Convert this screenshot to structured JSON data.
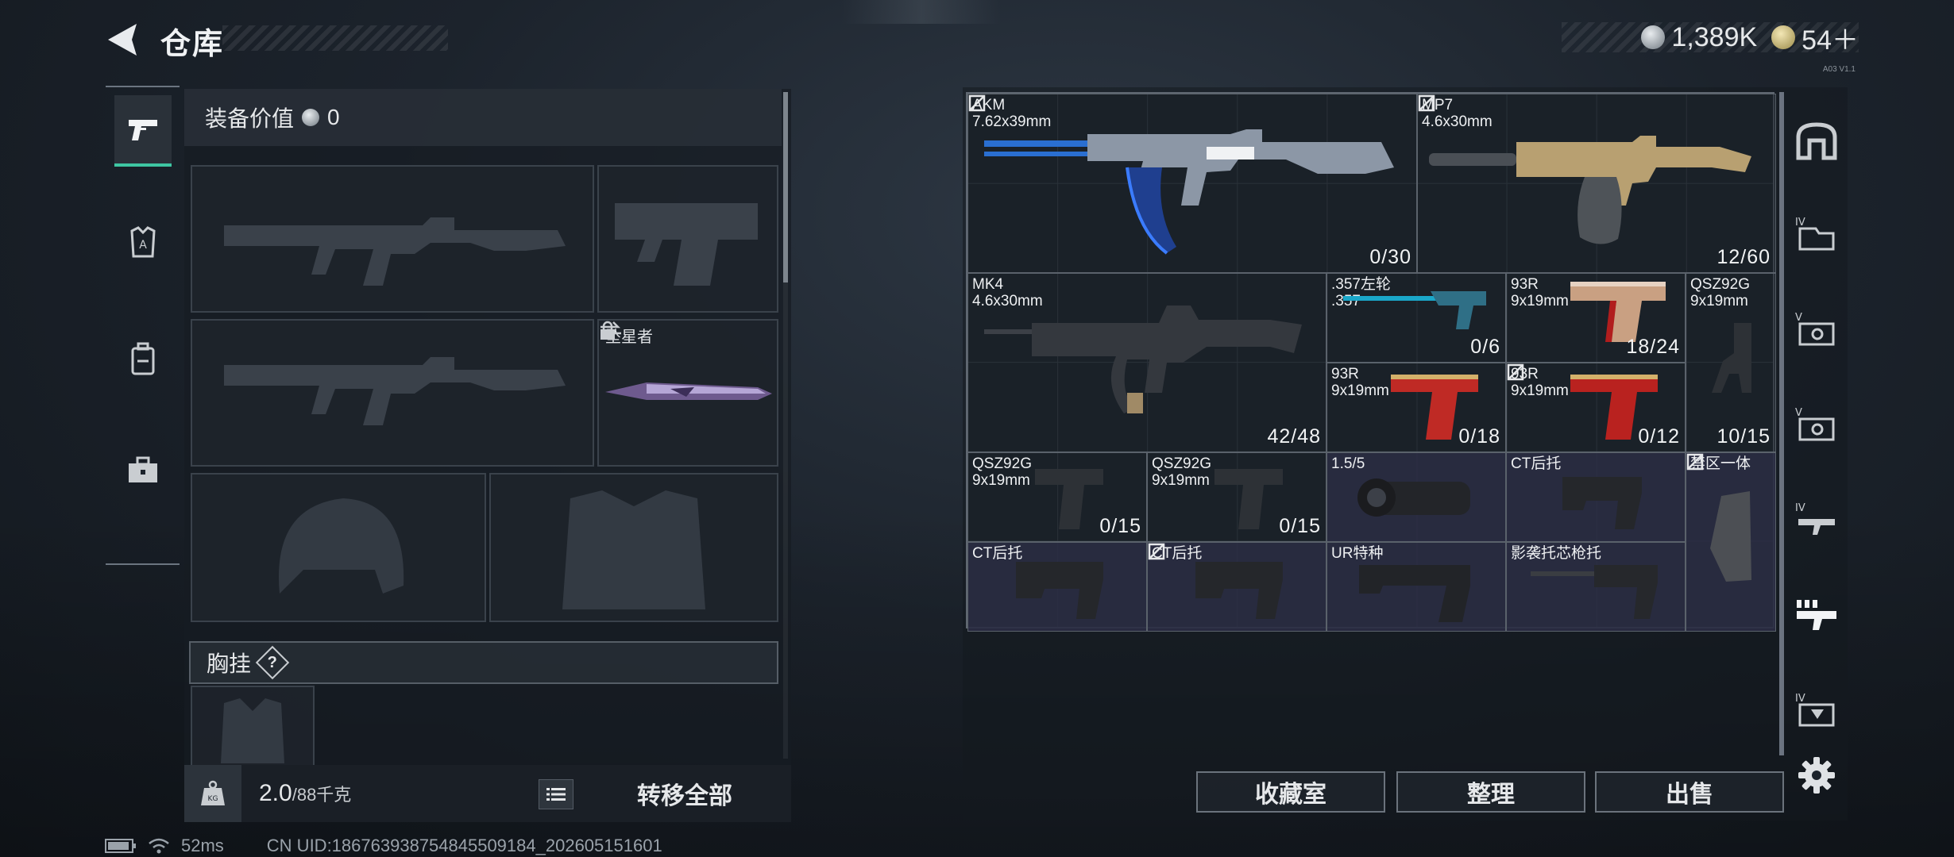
{
  "header": {
    "title": "仓库",
    "currencies": [
      {
        "icon": "silver-coin-icon",
        "value": "1,389K"
      },
      {
        "icon": "gold-badge-icon",
        "value": "54＋"
      }
    ],
    "build_tag": "A03 V1.1"
  },
  "left_nav": [
    {
      "name": "weapons",
      "icon": "pistol-icon",
      "active": true
    },
    {
      "name": "armor",
      "icon": "armor-icon",
      "active": false
    },
    {
      "name": "backpack",
      "icon": "backpack-icon",
      "active": false
    },
    {
      "name": "toolbox",
      "icon": "toolbox-icon",
      "active": false
    }
  ],
  "equipment": {
    "value_label": "装备价值",
    "value": "0",
    "melee_label": "坠星者",
    "chest_label": "胸挂",
    "help": "?",
    "weight": "2.0",
    "weight_capacity": "/88千克",
    "weight_icon_text": "KG",
    "transfer_all": "转移全部"
  },
  "storage": {
    "items": [
      {
        "name": "AKM",
        "caliber": "7.62x39mm",
        "ammo": "0/30"
      },
      {
        "name": "MP7",
        "caliber": "4.6x30mm",
        "ammo": "12/60"
      },
      {
        "name": "MK4",
        "caliber": "4.6x30mm",
        "ammo": "42/48"
      },
      {
        "name": ".357左轮",
        "caliber": ".357",
        "ammo": "0/6"
      },
      {
        "name": "93R",
        "caliber": "9x19mm",
        "ammo": "18/24"
      },
      {
        "name": "QSZ92G",
        "caliber": "9x19mm",
        "ammo": "10/15"
      },
      {
        "name": "93R",
        "caliber": "9x19mm",
        "ammo": "0/18"
      },
      {
        "name": "93R",
        "caliber": "9x19mm",
        "ammo": "0/12"
      },
      {
        "name": "QSZ92G",
        "caliber": "9x19mm",
        "ammo": "0/15"
      },
      {
        "name": "QSZ92G",
        "caliber": "9x19mm",
        "ammo": "0/15"
      },
      {
        "name": "1.5/5",
        "caliber": "",
        "ammo": ""
      },
      {
        "name": "CT后托",
        "caliber": "",
        "ammo": ""
      },
      {
        "name": "禁区一体",
        "caliber": "",
        "ammo": ""
      },
      {
        "name": "CT后托",
        "caliber": "",
        "ammo": ""
      },
      {
        "name": "CT后托",
        "caliber": "",
        "ammo": ""
      },
      {
        "name": "UR特种",
        "caliber": "",
        "ammo": ""
      },
      {
        "name": "影袭托芯枪托",
        "caliber": "",
        "ammo": ""
      }
    ]
  },
  "right_nav": [
    {
      "icon": "storage-home-icon"
    },
    {
      "icon": "folder-iv-icon"
    },
    {
      "icon": "safe-v-icon"
    },
    {
      "icon": "safe-v-icon-2"
    },
    {
      "icon": "rifle-iv-icon"
    },
    {
      "icon": "attachments-icon",
      "active": true
    },
    {
      "icon": "box-iv-icon"
    }
  ],
  "actions": {
    "collection": "收藏室",
    "sort": "整理",
    "sell": "出售"
  },
  "status": {
    "ping": "52ms",
    "uid": "CN UID:18676393875484550918​4_202605151601"
  },
  "colors": {
    "accent": "#3ec6a2",
    "panel": "#1c232c",
    "grid_line": "#5a626b",
    "attachment_cell": "#2a2c42"
  }
}
